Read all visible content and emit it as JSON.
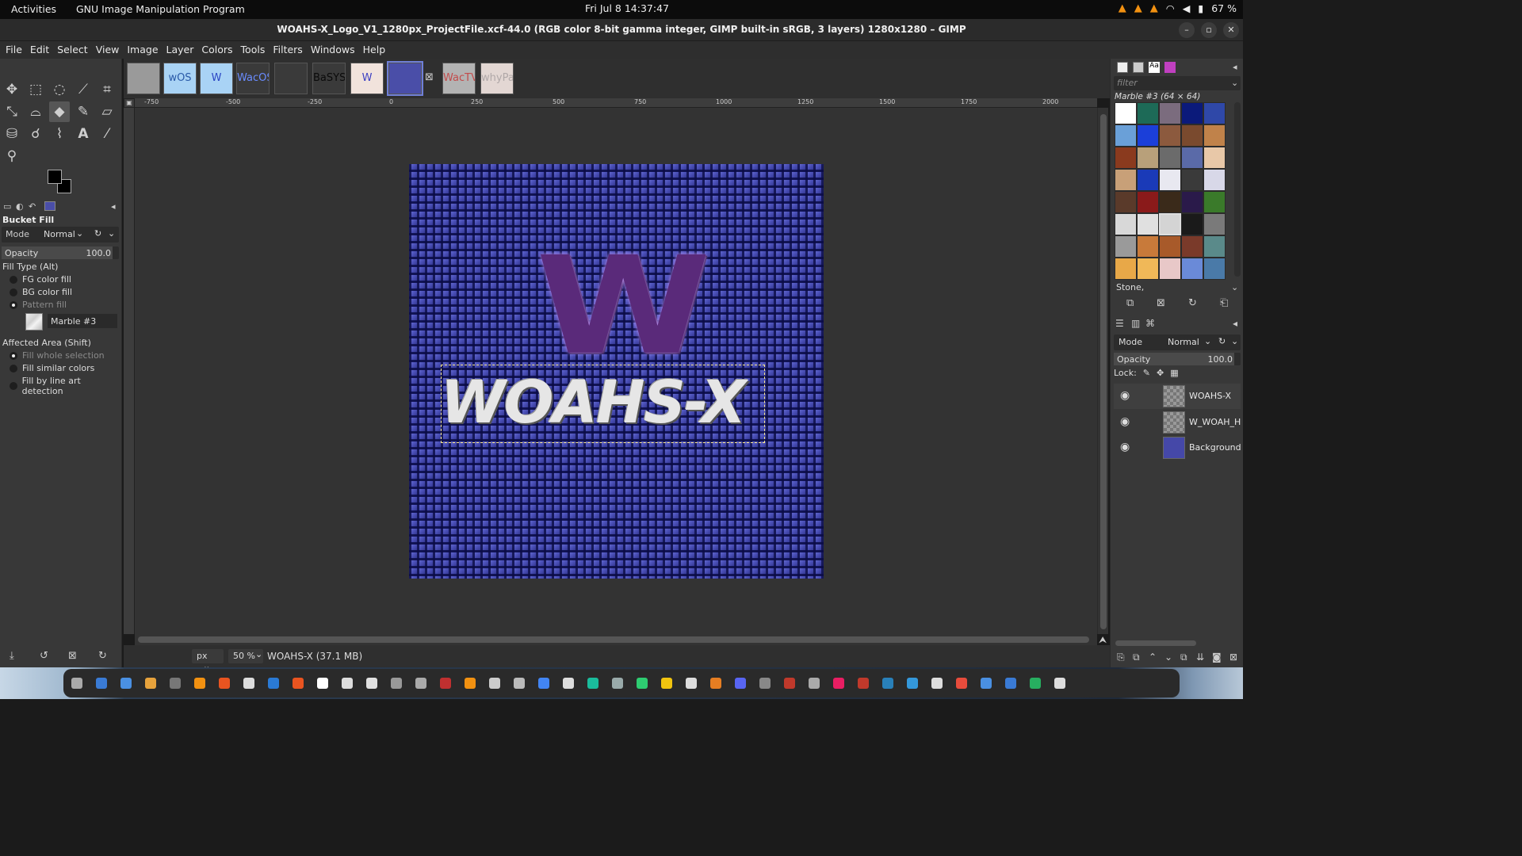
{
  "topbar": {
    "activities": "Activities",
    "app": "GNU Image Manipulation Program",
    "clock": "Fri Jul 8  14:37:47",
    "battery": "67 %"
  },
  "window": {
    "title": "WOAHS-X_Logo_V1_1280px_ProjectFile.xcf-44.0 (RGB color 8-bit gamma integer, GIMP built-in sRGB, 3 layers) 1280x1280 – GIMP"
  },
  "menu": [
    "File",
    "Edit",
    "Select",
    "View",
    "Image",
    "Layer",
    "Colors",
    "Tools",
    "Filters",
    "Windows",
    "Help"
  ],
  "image_tabs": [
    {
      "label": "",
      "bg": "#9a9a9a",
      "color": "#666"
    },
    {
      "label": "wOS",
      "bg": "#a9d3f5",
      "color": "#2a5aa8"
    },
    {
      "label": "W",
      "bg": "#a9d3f5",
      "color": "#2b46c4"
    },
    {
      "label": "WacOS",
      "bg": "#3a3a3a",
      "color": "#6a8cff"
    },
    {
      "label": "",
      "bg": "#3a3a3a",
      "color": "#777"
    },
    {
      "label": "BaSYS",
      "bg": "#3a3a3a",
      "color": "#0a0a0a"
    },
    {
      "label": "W",
      "bg": "#f1e3dc",
      "color": "#3b3fc2"
    },
    {
      "label": "",
      "bg": "#4a4ea8",
      "color": "#aaa"
    },
    {
      "label": "WacTVOS",
      "bg": "#b3b3b3",
      "color": "#c24b4b"
    },
    {
      "label": "whyPadOS",
      "bg": "#e3d7d3",
      "color": "#b0a8a8"
    }
  ],
  "tool_options": {
    "title": "Bucket Fill",
    "mode_label": "Mode",
    "mode_value": "Normal",
    "opacity_label": "Opacity",
    "opacity_value": "100.0",
    "fill_type_label": "Fill Type  (Alt)",
    "fill_types": [
      "FG color fill",
      "BG color fill",
      "Pattern fill"
    ],
    "pattern_name": "Marble #3",
    "affected_area_label": "Affected Area  (Shift)",
    "affected_options": [
      "Fill whole selection",
      "Fill similar colors",
      "Fill by line art detection"
    ]
  },
  "canvas": {
    "logo_letter": "W",
    "logo_text": "WOAHS-X",
    "ruler_labels": [
      "-750",
      "-500",
      "-250",
      "0",
      "250",
      "500",
      "750",
      "1000",
      "1250",
      "1500",
      "1750",
      "2000"
    ]
  },
  "status": {
    "unit": "px",
    "zoom": "50 %",
    "info": "WOAHS-X (37.1 MB)"
  },
  "patterns": {
    "filter_placeholder": "filter",
    "title": "Marble #3 (64 × 64)",
    "tag": "Stone,",
    "swatches": [
      "#ffffff",
      "#1d6a57",
      "#7b6c7e",
      "#0b1a7a",
      "#2f48a8",
      "#6aa0d8",
      "#1b3fd9",
      "#8c5a3e",
      "#7a4a2e",
      "#c0824a",
      "#8a3a1e",
      "#b8a07a",
      "#6b6b6b",
      "#5a6aa8",
      "#e8c8a8",
      "#c8a078",
      "#1a3ab8",
      "#e8e8f0",
      "#3a3a3a",
      "#d8d8e8",
      "#5a3a2a",
      "#8a1a1a",
      "#3a2a1a",
      "#2a1a4a",
      "#3a7a2a",
      "#d8d8d8",
      "#e0e0e0",
      "#d4d4d4",
      "#1a1a1a",
      "#7a7a7a",
      "#9a9a9a",
      "#c87a3a",
      "#a85a2a",
      "#7a3a2a",
      "#5a8a8a",
      "#e8a848",
      "#f0b858",
      "#e8c8c8",
      "#6a8ad8",
      "#4a7aa8"
    ]
  },
  "layers": {
    "mode_label": "Mode",
    "mode_value": "Normal",
    "opacity_label": "Opacity",
    "opacity_value": "100.0",
    "lock_label": "Lock:",
    "items": [
      {
        "name": "WOAHS-X"
      },
      {
        "name": "W_WOAH_Hig"
      },
      {
        "name": "Background"
      }
    ]
  }
}
